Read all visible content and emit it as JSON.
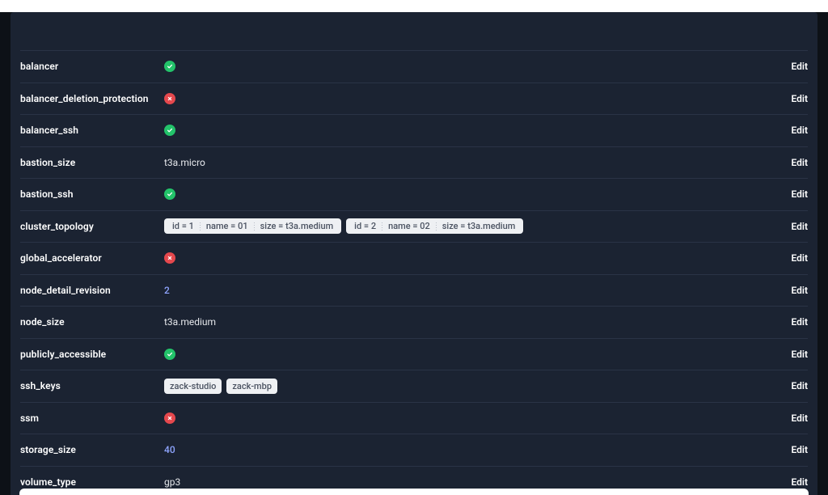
{
  "actions": {
    "edit": "Edit"
  },
  "rows": [
    {
      "key": "balancer",
      "type": "bool",
      "value": true
    },
    {
      "key": "balancer_deletion_protection",
      "type": "bool",
      "value": false
    },
    {
      "key": "balancer_ssh",
      "type": "bool",
      "value": true
    },
    {
      "key": "bastion_size",
      "type": "text",
      "value": "t3a.micro"
    },
    {
      "key": "bastion_ssh",
      "type": "bool",
      "value": true
    },
    {
      "key": "cluster_topology",
      "type": "objects",
      "value": [
        {
          "id": "1",
          "name": "01",
          "size": "t3a.medium"
        },
        {
          "id": "2",
          "name": "02",
          "size": "t3a.medium"
        }
      ]
    },
    {
      "key": "global_accelerator",
      "type": "bool",
      "value": false
    },
    {
      "key": "node_detail_revision",
      "type": "number",
      "value": "2"
    },
    {
      "key": "node_size",
      "type": "text",
      "value": "t3a.medium"
    },
    {
      "key": "publicly_accessible",
      "type": "bool",
      "value": true
    },
    {
      "key": "ssh_keys",
      "type": "tags",
      "value": [
        "zack-studio",
        "zack-mbp"
      ]
    },
    {
      "key": "ssm",
      "type": "bool",
      "value": false
    },
    {
      "key": "storage_size",
      "type": "number",
      "value": "40"
    },
    {
      "key": "volume_type",
      "type": "text",
      "value": "gp3"
    }
  ]
}
